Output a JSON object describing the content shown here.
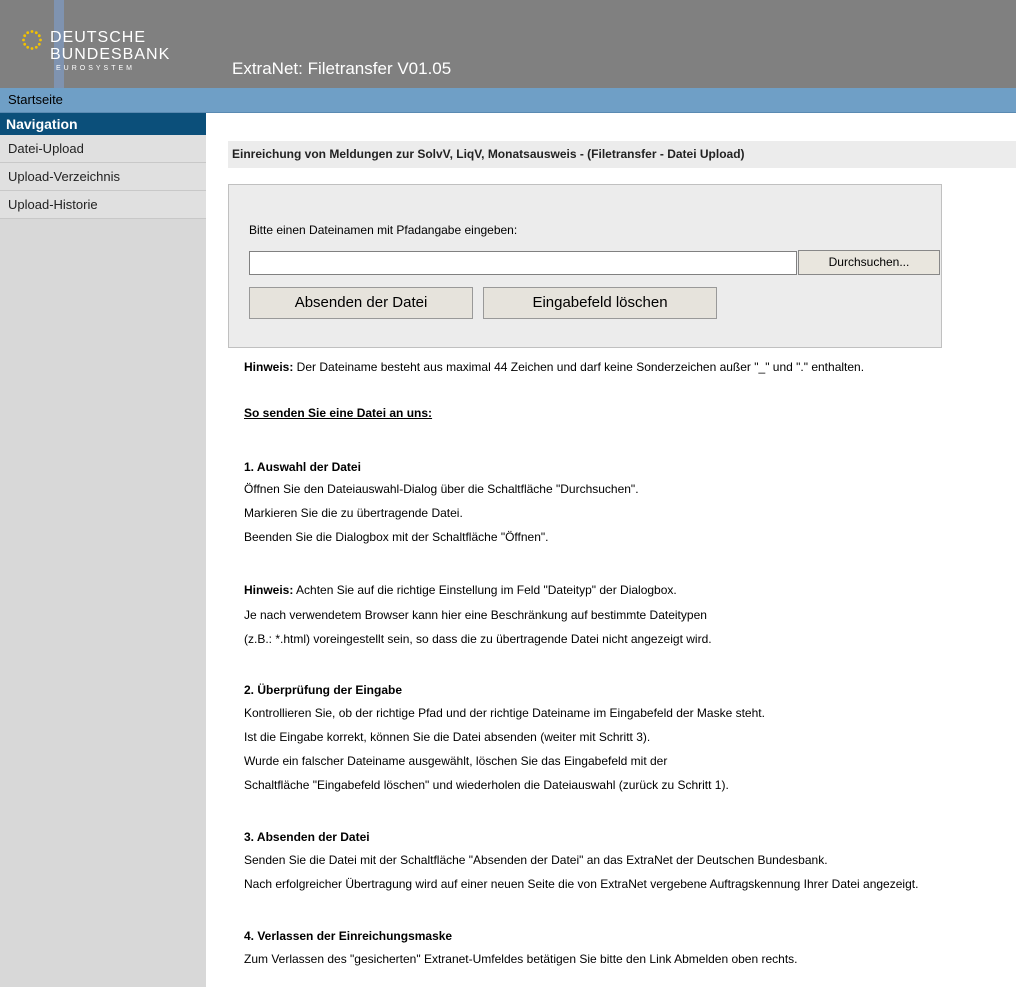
{
  "logo": {
    "line1": "DEUTSCHE",
    "line2": "BUNDESBANK",
    "line3": "EUROSYSTEM"
  },
  "app_title": "ExtraNet: Filetransfer V01.05",
  "topbar": {
    "start": "Startseite"
  },
  "sidebar": {
    "heading": "Navigation",
    "items": [
      {
        "label": "Datei-Upload"
      },
      {
        "label": "Upload-Verzeichnis"
      },
      {
        "label": "Upload-Historie"
      }
    ]
  },
  "main": {
    "section_title": "Einreichung von Meldungen zur SolvV, LiqV, Monatsausweis - (Filetransfer - Datei Upload)",
    "upload": {
      "label": "Bitte einen Dateinamen mit Pfadangabe eingeben:",
      "file_value": "",
      "browse_label": "Durchsuchen...",
      "submit_label": "Absenden der Datei",
      "clear_label": "Eingabefeld löschen"
    },
    "hinweis1_prefix": "Hinweis:",
    "hinweis1_text": " Der Dateiname besteht aus maximal 44 Zeichen und darf keine Sonderzeichen außer \"_\" und \".\" enthalten.",
    "howto_title": "So senden Sie eine Datei an uns:",
    "s1_title": "1. Auswahl der Datei",
    "s1_l1": "Öffnen Sie den Dateiauswahl-Dialog über die Schaltfläche \"Durchsuchen\".",
    "s1_l2": "Markieren Sie die zu übertragende Datei.",
    "s1_l3": "Beenden Sie die Dialogbox mit der Schaltfläche \"Öffnen\".",
    "hinweis2_prefix": "Hinweis:",
    "hinweis2_text": " Achten Sie auf die richtige Einstellung im Feld \"Dateityp\" der Dialogbox.",
    "h2_l2": "Je nach verwendetem Browser kann hier eine Beschränkung auf bestimmte Dateitypen",
    "h2_l3": "(z.B.: *.html) voreingestellt sein, so dass die zu übertragende Datei nicht angezeigt wird.",
    "s2_title": "2. Überprüfung der Eingabe",
    "s2_l1": "Kontrollieren Sie, ob der richtige Pfad und der richtige Dateiname im Eingabefeld der Maske steht.",
    "s2_l2": "Ist die Eingabe korrekt, können Sie die Datei absenden (weiter mit Schritt 3).",
    "s2_l3": "Wurde ein falscher Dateiname ausgewählt, löschen Sie das Eingabefeld mit der",
    "s2_l4": "Schaltfläche \"Eingabefeld löschen\" und wiederholen die Dateiauswahl (zurück zu Schritt 1).",
    "s3_title": "3. Absenden der Datei",
    "s3_l1": "Senden Sie die Datei mit der Schaltfläche \"Absenden der Datei\" an das ExtraNet der Deutschen Bundesbank.",
    "s3_l2": "Nach erfolgreicher Übertragung wird auf einer neuen Seite die von ExtraNet vergebene Auftragskennung Ihrer Datei angezeigt.",
    "s4_title": "4. Verlassen der Einreichungsmaske",
    "s4_l1": "Zum Verlassen des \"gesicherten\" Extranet-Umfeldes betätigen Sie bitte den Link Abmelden oben rechts."
  }
}
